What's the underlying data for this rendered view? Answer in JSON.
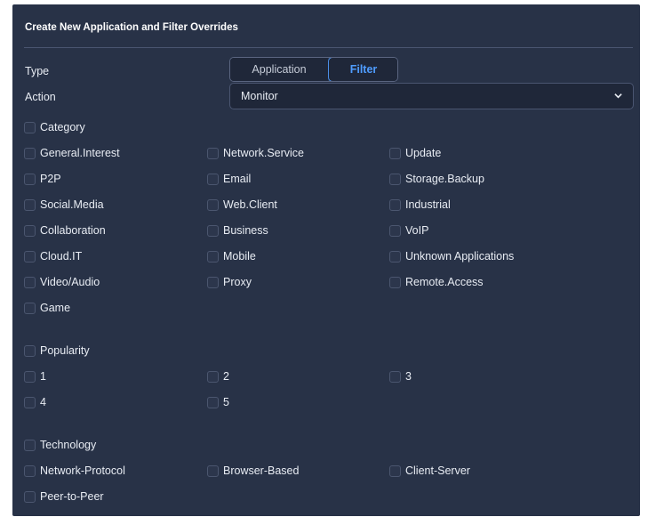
{
  "title": "Create New Application and Filter Overrides",
  "type_row": {
    "label": "Type",
    "options": [
      "Application",
      "Filter"
    ],
    "selected": "Filter"
  },
  "action_row": {
    "label": "Action",
    "value": "Monitor"
  },
  "category": {
    "header": "Category",
    "items": [
      "General.Interest",
      "Network.Service",
      "Update",
      "P2P",
      "Email",
      "Storage.Backup",
      "Social.Media",
      "Web.Client",
      "Industrial",
      "Collaboration",
      "Business",
      "VoIP",
      "Cloud.IT",
      "Mobile",
      "Unknown Applications",
      "Video/Audio",
      "Proxy",
      "Remote.Access",
      "Game"
    ]
  },
  "popularity": {
    "header": "Popularity",
    "items": [
      "1",
      "2",
      "3",
      "4",
      "5"
    ]
  },
  "technology": {
    "header": "Technology",
    "items": [
      "Network-Protocol",
      "Browser-Based",
      "Client-Server",
      "Peer-to-Peer"
    ]
  },
  "colors": {
    "panel_bg": "#283247",
    "accent": "#4f9dff",
    "text": "#e8ecf3"
  }
}
